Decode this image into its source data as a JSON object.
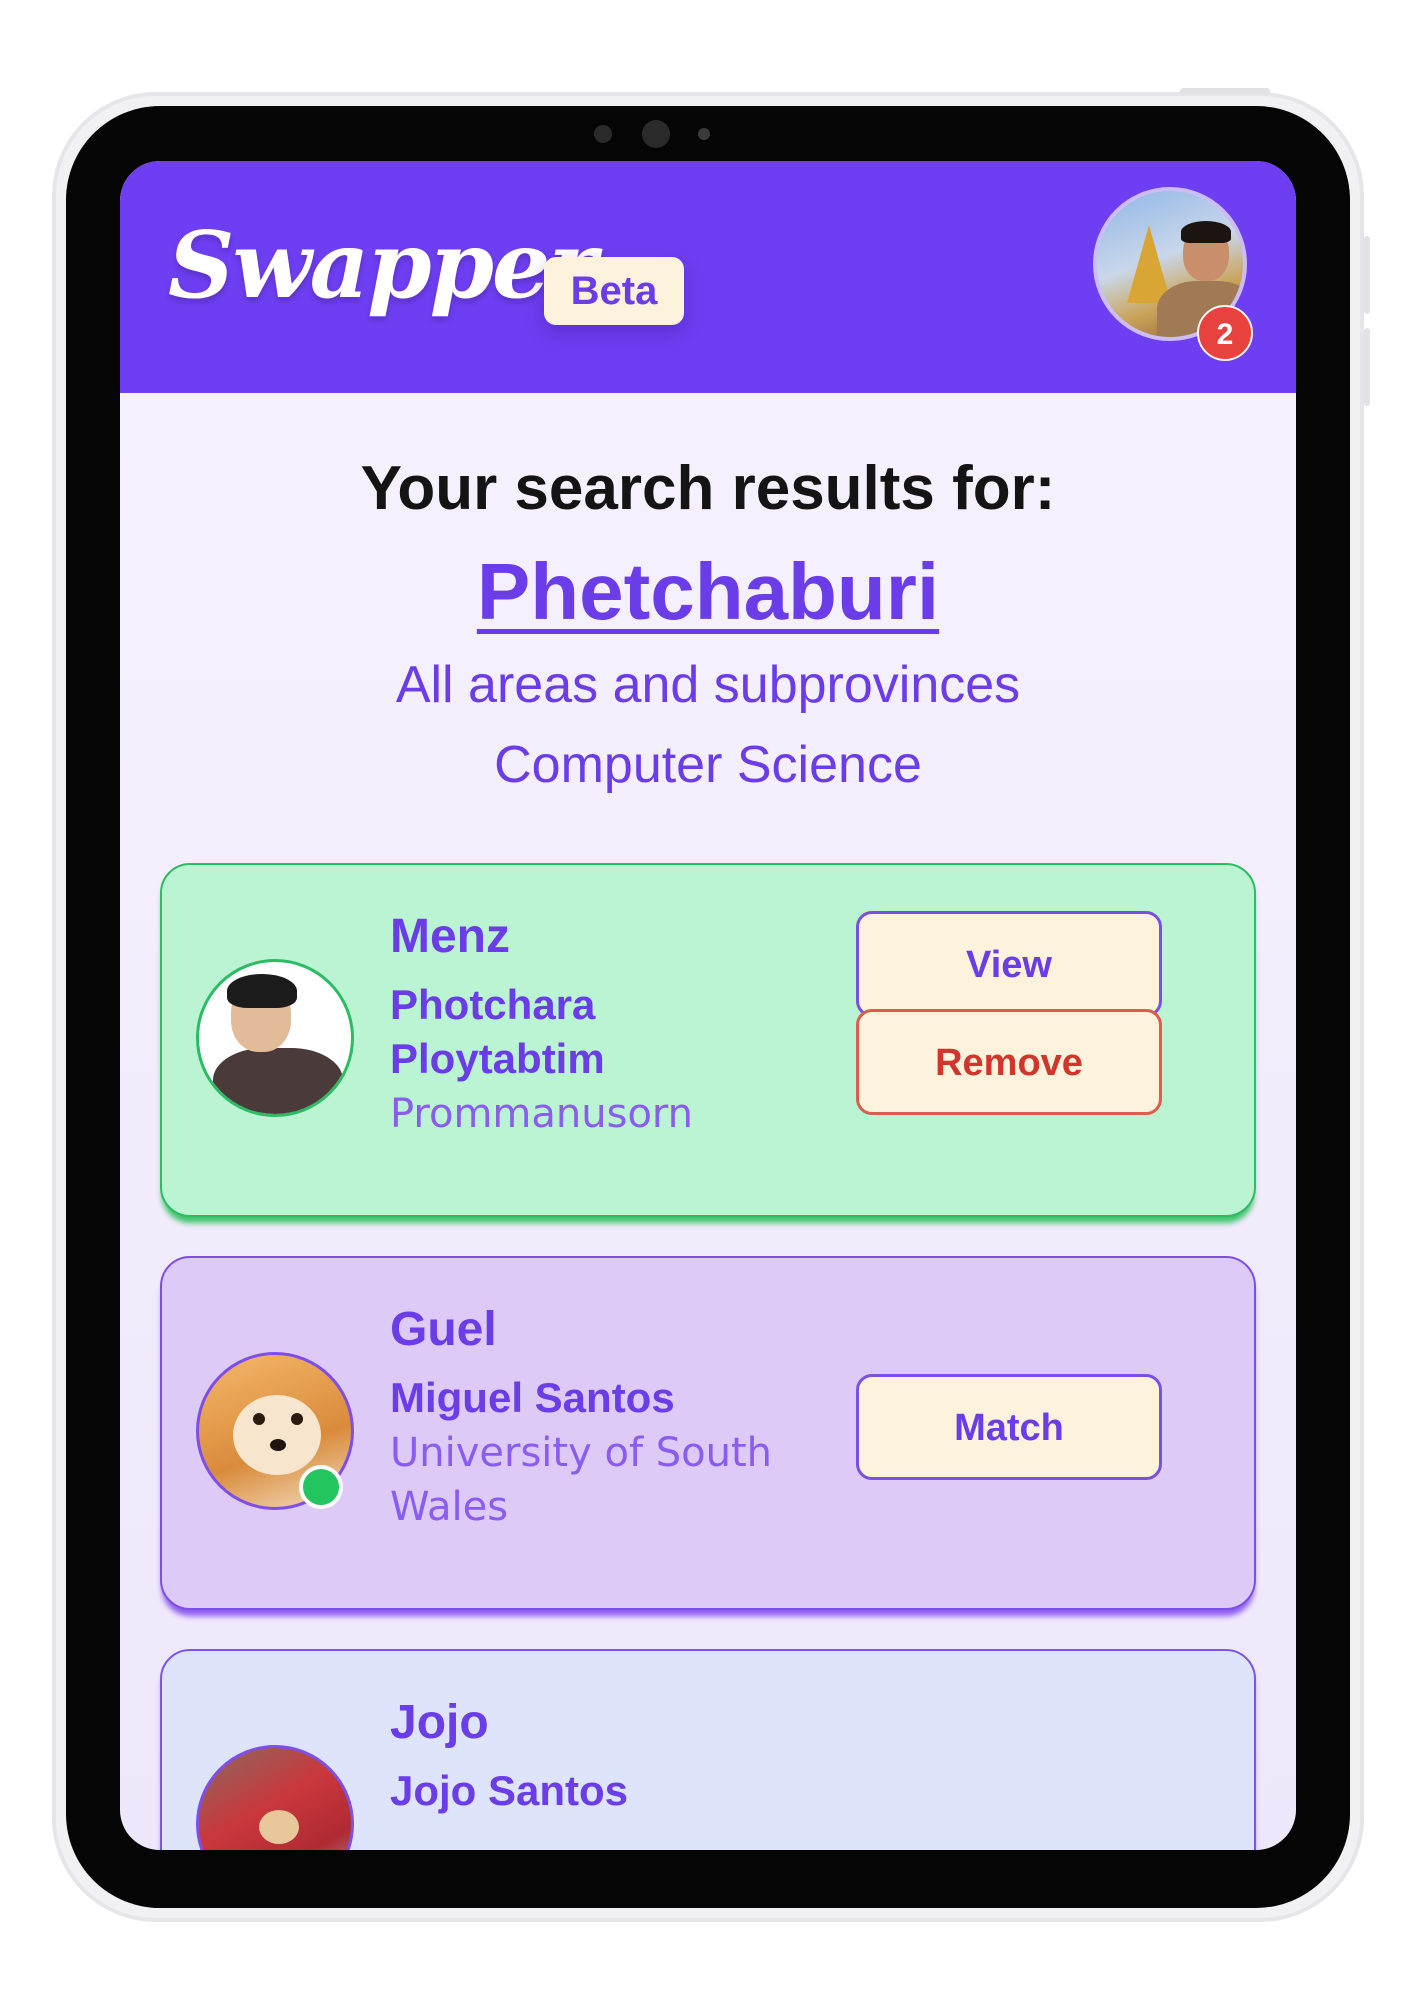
{
  "header": {
    "logo": "Swapper",
    "badge": "Beta",
    "notification_count": "2"
  },
  "search": {
    "title": "Your search results for:",
    "location": "Phetchaburi",
    "area": "All areas and subprovinces",
    "field": "Computer Science"
  },
  "results": [
    {
      "nickname": "Menz",
      "lines": [
        "Photchara",
        "Ploytabtim",
        "Prommanusorn"
      ],
      "buttons": [
        "View",
        "Remove"
      ],
      "status_color": "#bbf4d3"
    },
    {
      "nickname": "Guel",
      "lines": [
        "Miguel Santos",
        "University of South",
        "Wales"
      ],
      "buttons": [
        "Match"
      ],
      "online": true,
      "status_color": "#ddcaf7"
    },
    {
      "nickname": "Jojo",
      "lines": [
        "Jojo Santos"
      ],
      "status_color": "#dde4fc"
    }
  ],
  "colors": {
    "primary": "#6e3ef2",
    "accent_text": "#6a3de8",
    "remove": "#d0362c",
    "online": "#22c55e",
    "notification": "#e8423f"
  }
}
